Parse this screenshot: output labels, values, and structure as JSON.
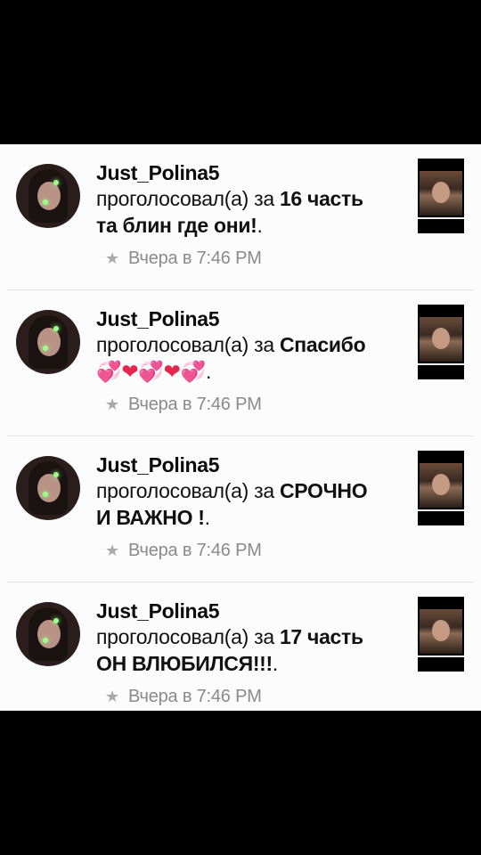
{
  "notifications": [
    {
      "username": "Just_Polina5",
      "action": "проголосовал(а) за ",
      "title_line1": "16 часть",
      "title_line2": "та блин где они!",
      "suffix": ".",
      "time": "Вчера в 7:46 PM"
    },
    {
      "username": "Just_Polina5",
      "action": "проголосовал(а) за ",
      "title_line1": "Спасибо",
      "title_line2": "💞❤💞❤💞",
      "suffix": ".",
      "time": "Вчера в 7:46 PM"
    },
    {
      "username": "Just_Polina5",
      "action": "проголосовал(а) за ",
      "title_line1": "СРОЧНО",
      "title_line2": "И ВАЖНО !",
      "suffix": ".",
      "time": "Вчера в 7:46 PM"
    },
    {
      "username": "Just_Polina5",
      "action": "проголосовал(а) за ",
      "title_line1": "17 часть",
      "title_line2": "ОН ВЛЮБИЛСЯ!!!",
      "suffix": ".",
      "time": "Вчера в 7:46 PM"
    }
  ],
  "icons": {
    "star": "star-icon"
  }
}
